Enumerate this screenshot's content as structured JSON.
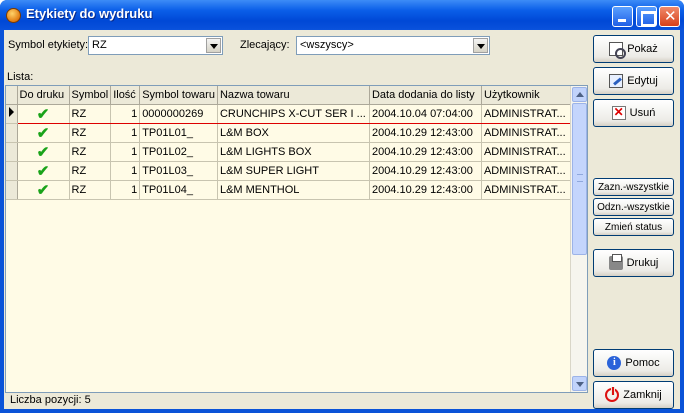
{
  "window": {
    "title": "Etykiety do wydruku"
  },
  "filters": {
    "symbol_label": "Symbol etykiety:",
    "symbol_value": "RZ",
    "client_label": "Zlecający:",
    "client_value": "<wszyscy>"
  },
  "list": {
    "label": "Lista:",
    "columns": [
      "Do druku",
      "Symbol",
      "Ilość",
      "Symbol towaru",
      "Nazwa towaru",
      "Data dodania do listy",
      "Użytkownik"
    ],
    "rows": [
      {
        "print": "✔",
        "symbol": "RZ",
        "qty": "1",
        "item_symbol": "0000000269",
        "name": "CRUNCHIPS X-CUT SER I ...",
        "date": "2004.10.04 07:04:00",
        "user": "ADMINISTRAT..."
      },
      {
        "print": "✔",
        "symbol": "RZ",
        "qty": "1",
        "item_symbol": "TP01L01_",
        "name": "L&M BOX",
        "date": "2004.10.29 12:43:00",
        "user": "ADMINISTRAT..."
      },
      {
        "print": "✔",
        "symbol": "RZ",
        "qty": "1",
        "item_symbol": "TP01L02_",
        "name": "L&M LIGHTS BOX",
        "date": "2004.10.29 12:43:00",
        "user": "ADMINISTRAT..."
      },
      {
        "print": "✔",
        "symbol": "RZ",
        "qty": "1",
        "item_symbol": "TP01L03_",
        "name": "L&M SUPER LIGHT",
        "date": "2004.10.29 12:43:00",
        "user": "ADMINISTRAT..."
      },
      {
        "print": "✔",
        "symbol": "RZ",
        "qty": "1",
        "item_symbol": "TP01L04_",
        "name": "L&M MENTHOL",
        "date": "2004.10.29 12:43:00",
        "user": "ADMINISTRAT..."
      }
    ]
  },
  "buttons": {
    "show": "Pokaż",
    "edit": "Edytuj",
    "delete": "Usuń",
    "select_all": "Zazn.-wszystkie",
    "deselect_all": "Odzn.-wszystkie",
    "change_status": "Zmień status",
    "print": "Drukuj",
    "help": "Pomoc",
    "close": "Zamknij"
  },
  "status": {
    "count": "Liczba pozycji: 5"
  },
  "colors": {
    "grid_bg": "#fffbe6",
    "check_green": "#1aa31a",
    "selected_border": "#dd0000"
  }
}
